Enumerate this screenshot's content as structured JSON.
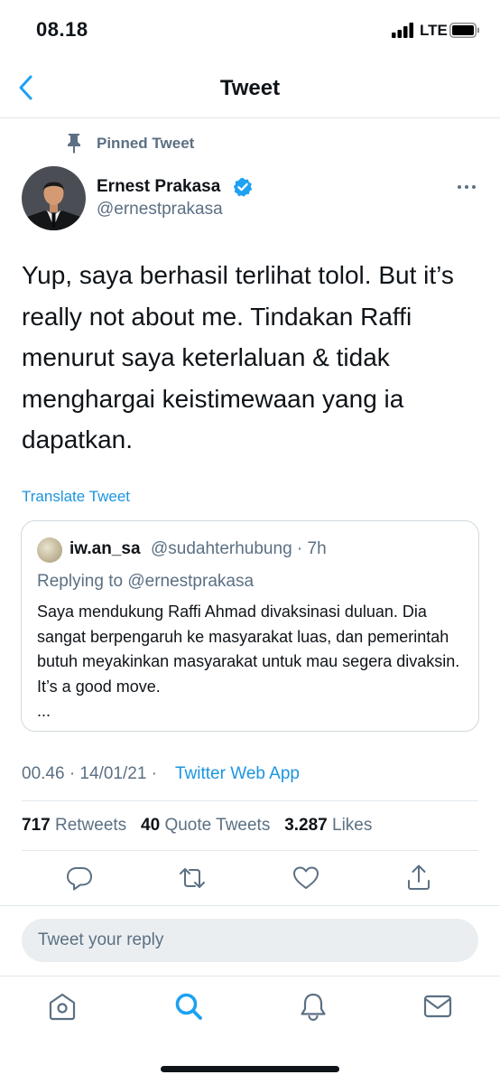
{
  "status_bar": {
    "time": "08.18",
    "network": "LTE"
  },
  "header": {
    "title": "Tweet"
  },
  "tweet": {
    "pinned_label": "Pinned Tweet",
    "author_name": "Ernest Prakasa",
    "author_handle": "@ernestprakasa",
    "verified": true,
    "text": "Yup, saya berhasil terlihat tolol. But it’s really not about me. Tindakan Raffi menurut saya keterlaluan & tidak menghargai keistimewaan yang ia dapatkan.",
    "translate_label": "Translate Tweet",
    "timestamp": "00.46 · 14/01/21 ·",
    "source": "Twitter Web App"
  },
  "quoted_tweet": {
    "author_name": "iw.an_sa",
    "author_handle": "@sudahterhubung · 7h",
    "replying_to": "Replying to @ernestprakasa",
    "text": "Saya mendukung Raffi Ahmad divaksinasi duluan. Dia sangat berpengaruh ke masyarakat luas, dan pemerintah butuh meyakinkan masyarakat untuk mau segera divaksin. It’s a good move.",
    "ellipsis": "..."
  },
  "stats": {
    "retweets_count": "717",
    "retweets_label": "Retweets",
    "quotes_count": "40",
    "quotes_label": "Quote Tweets",
    "likes_count": "3.287",
    "likes_label": "Likes"
  },
  "actions": [
    "reply-icon",
    "retweet-icon",
    "like-icon",
    "share-icon"
  ],
  "reply_box": {
    "placeholder": "Tweet your reply"
  },
  "tab_bar": [
    "home-icon",
    "search-icon",
    "notifications-icon",
    "messages-icon"
  ],
  "colors": {
    "accent": "#1da1f2",
    "link": "#1b95e0",
    "secondary_text": "#5b7083",
    "divider": "#e1e8ed"
  }
}
